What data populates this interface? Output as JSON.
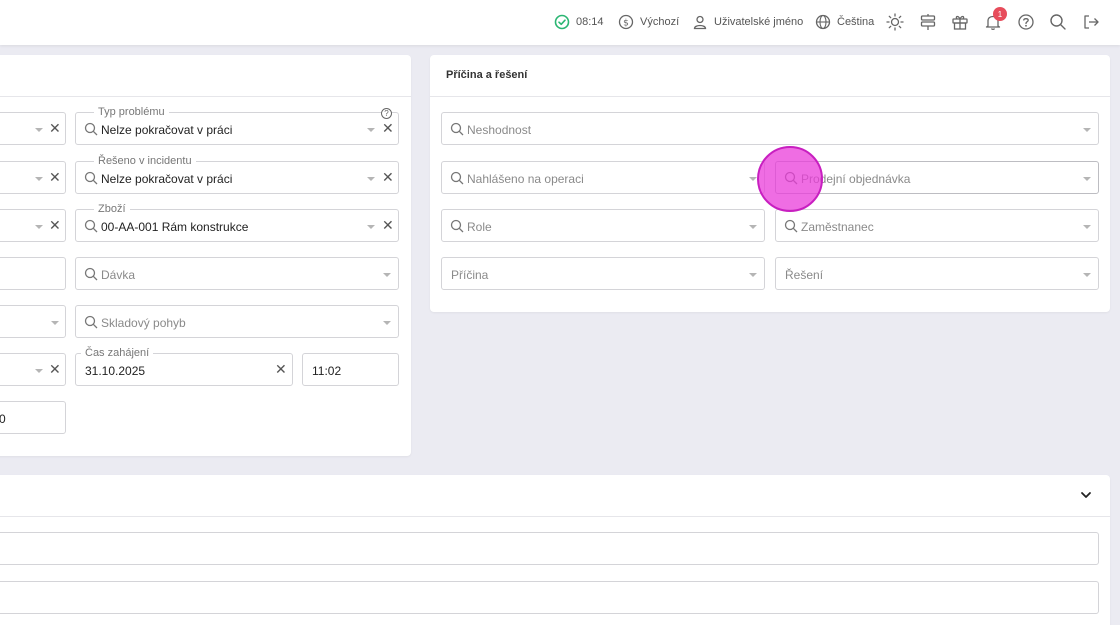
{
  "topbar": {
    "time": "08:14",
    "currency_label": "Výchozí",
    "user_label": "Uživatelské jméno",
    "language_label": "Čeština",
    "notifications_count": "1",
    "status_color": "#2bb673"
  },
  "left_form": {
    "typ_problemu": {
      "label": "Typ problému",
      "value": "Nelze pokračovat v práci"
    },
    "reseno_v_incidentu": {
      "label": "Řešeno v incidentu",
      "value": "Nelze pokračovat v práci"
    },
    "zbozi": {
      "label": "Zboží",
      "value": "00-AA-001 Rám konstrukce"
    },
    "davka": {
      "placeholder": "Dávka"
    },
    "skladovy_pohyb": {
      "placeholder": "Skladový pohyb"
    },
    "cas_zahajeni": {
      "label": "Čas zahájení",
      "date": "31.10.2025",
      "time": "11:02"
    },
    "partial_value": "0"
  },
  "pricina_card": {
    "title": "Příčina a řešení",
    "neshodnost": "Neshodnost",
    "nahlaseno_na_operaci": "Nahlášeno na operaci",
    "prodejni_objednavka": "Prodejní objednávka",
    "role": "Role",
    "zamestnanec": "Zaměstnanec",
    "pricina": "Příčina",
    "reseni": "Řešení"
  },
  "icons": {
    "status": "check-circle-icon",
    "currency": "dollar-circle-icon",
    "user": "user-icon",
    "language": "globe-icon",
    "theme": "sun-icon",
    "signpost": "signpost-icon",
    "gift": "gift-icon",
    "notifications": "bell-icon",
    "help": "question-circle-icon",
    "search": "search-icon",
    "logout": "logout-icon",
    "collapse": "chevron-down-icon"
  },
  "colors": {
    "accent_highlight": "#ea3cda",
    "badge": "#e74c5b"
  }
}
